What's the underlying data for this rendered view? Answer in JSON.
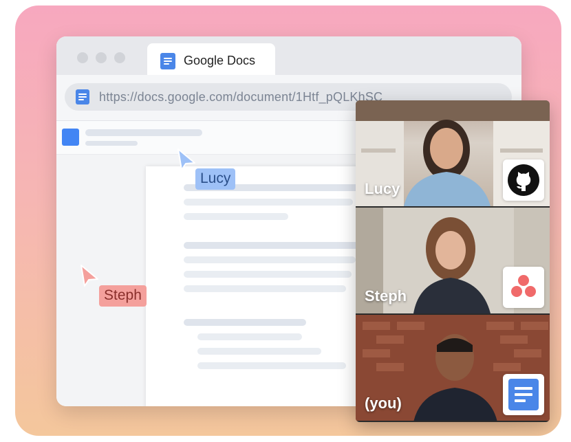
{
  "browser": {
    "tab_label": "Google Docs",
    "url": "https://docs.google.com/document/1Htf_pQLKhSC"
  },
  "cursors": [
    {
      "name": "Lucy",
      "color": "#9ec1f7",
      "text_color": "#2a4f8a"
    },
    {
      "name": "Steph",
      "color": "#f4a09c",
      "text_color": "#8a2f2b"
    }
  ],
  "participants": [
    {
      "label": "Lucy",
      "app_icon": "github-icon"
    },
    {
      "label": "Steph",
      "app_icon": "asana-icon"
    },
    {
      "label": "(you)",
      "app_icon": "google-docs-icon"
    }
  ],
  "colors": {
    "docs_blue": "#4a86e8",
    "asana_red": "#f06a6a"
  }
}
